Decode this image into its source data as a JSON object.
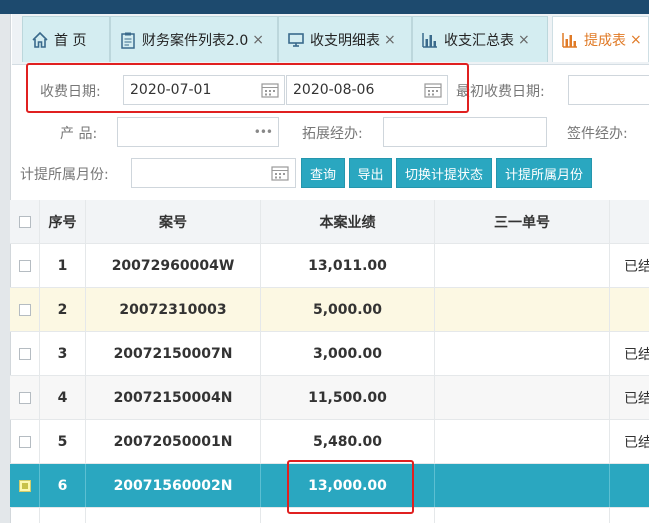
{
  "tabs": [
    {
      "label": "首 页",
      "icon": "home-icon",
      "closable": false
    },
    {
      "label": "财务案件列表2.0",
      "icon": "clipboard-icon",
      "closable": true
    },
    {
      "label": "收支明细表",
      "icon": "monitor-icon",
      "closable": true
    },
    {
      "label": "收支汇总表",
      "icon": "bar-chart-icon",
      "closable": true
    },
    {
      "label": "提成表",
      "icon": "bar-chart-icon",
      "closable": true,
      "active": true
    }
  ],
  "tab_close_symbol": "×",
  "filters": {
    "fee_date_label": "收费日期:",
    "fee_date_start": "2020-07-01",
    "fee_date_end": "2020-08-06",
    "initial_fee_date_label": "最初收费日期:",
    "product_label": "产 品:",
    "product_more": "•••",
    "expand_manager_label": "拓展经办:",
    "sign_manager_label": "签件经办:",
    "accrual_month_label": "计提所属月份:"
  },
  "buttons": {
    "query": "查询",
    "export": "导出",
    "toggle_status": "切换计提状态",
    "accrual_month": "计提所属月份"
  },
  "table": {
    "headers": {
      "index": "序号",
      "case_no": "案号",
      "performance": "本案业绩",
      "third_order": "三一单号",
      "status": ""
    },
    "rows": [
      {
        "index": "1",
        "case_no": "20072960004W",
        "performance": "13,011.00",
        "third_order": "",
        "status": "已结"
      },
      {
        "index": "2",
        "case_no": "20072310003",
        "performance": "5,000.00",
        "third_order": "",
        "status": ""
      },
      {
        "index": "3",
        "case_no": "20072150007N",
        "performance": "3,000.00",
        "third_order": "",
        "status": "已结"
      },
      {
        "index": "4",
        "case_no": "20072150004N",
        "performance": "11,500.00",
        "third_order": "",
        "status": "已结"
      },
      {
        "index": "5",
        "case_no": "20072050001N",
        "performance": "5,480.00",
        "third_order": "",
        "status": "已结"
      },
      {
        "index": "6",
        "case_no": "20071560002N",
        "performance": "13,000.00",
        "third_order": "",
        "status": ""
      }
    ]
  },
  "colors": {
    "accent": "#2aa7c0",
    "active_tab": "#e07a26",
    "highlight_box": "#e02020",
    "top_bar": "#1d4a6e"
  }
}
